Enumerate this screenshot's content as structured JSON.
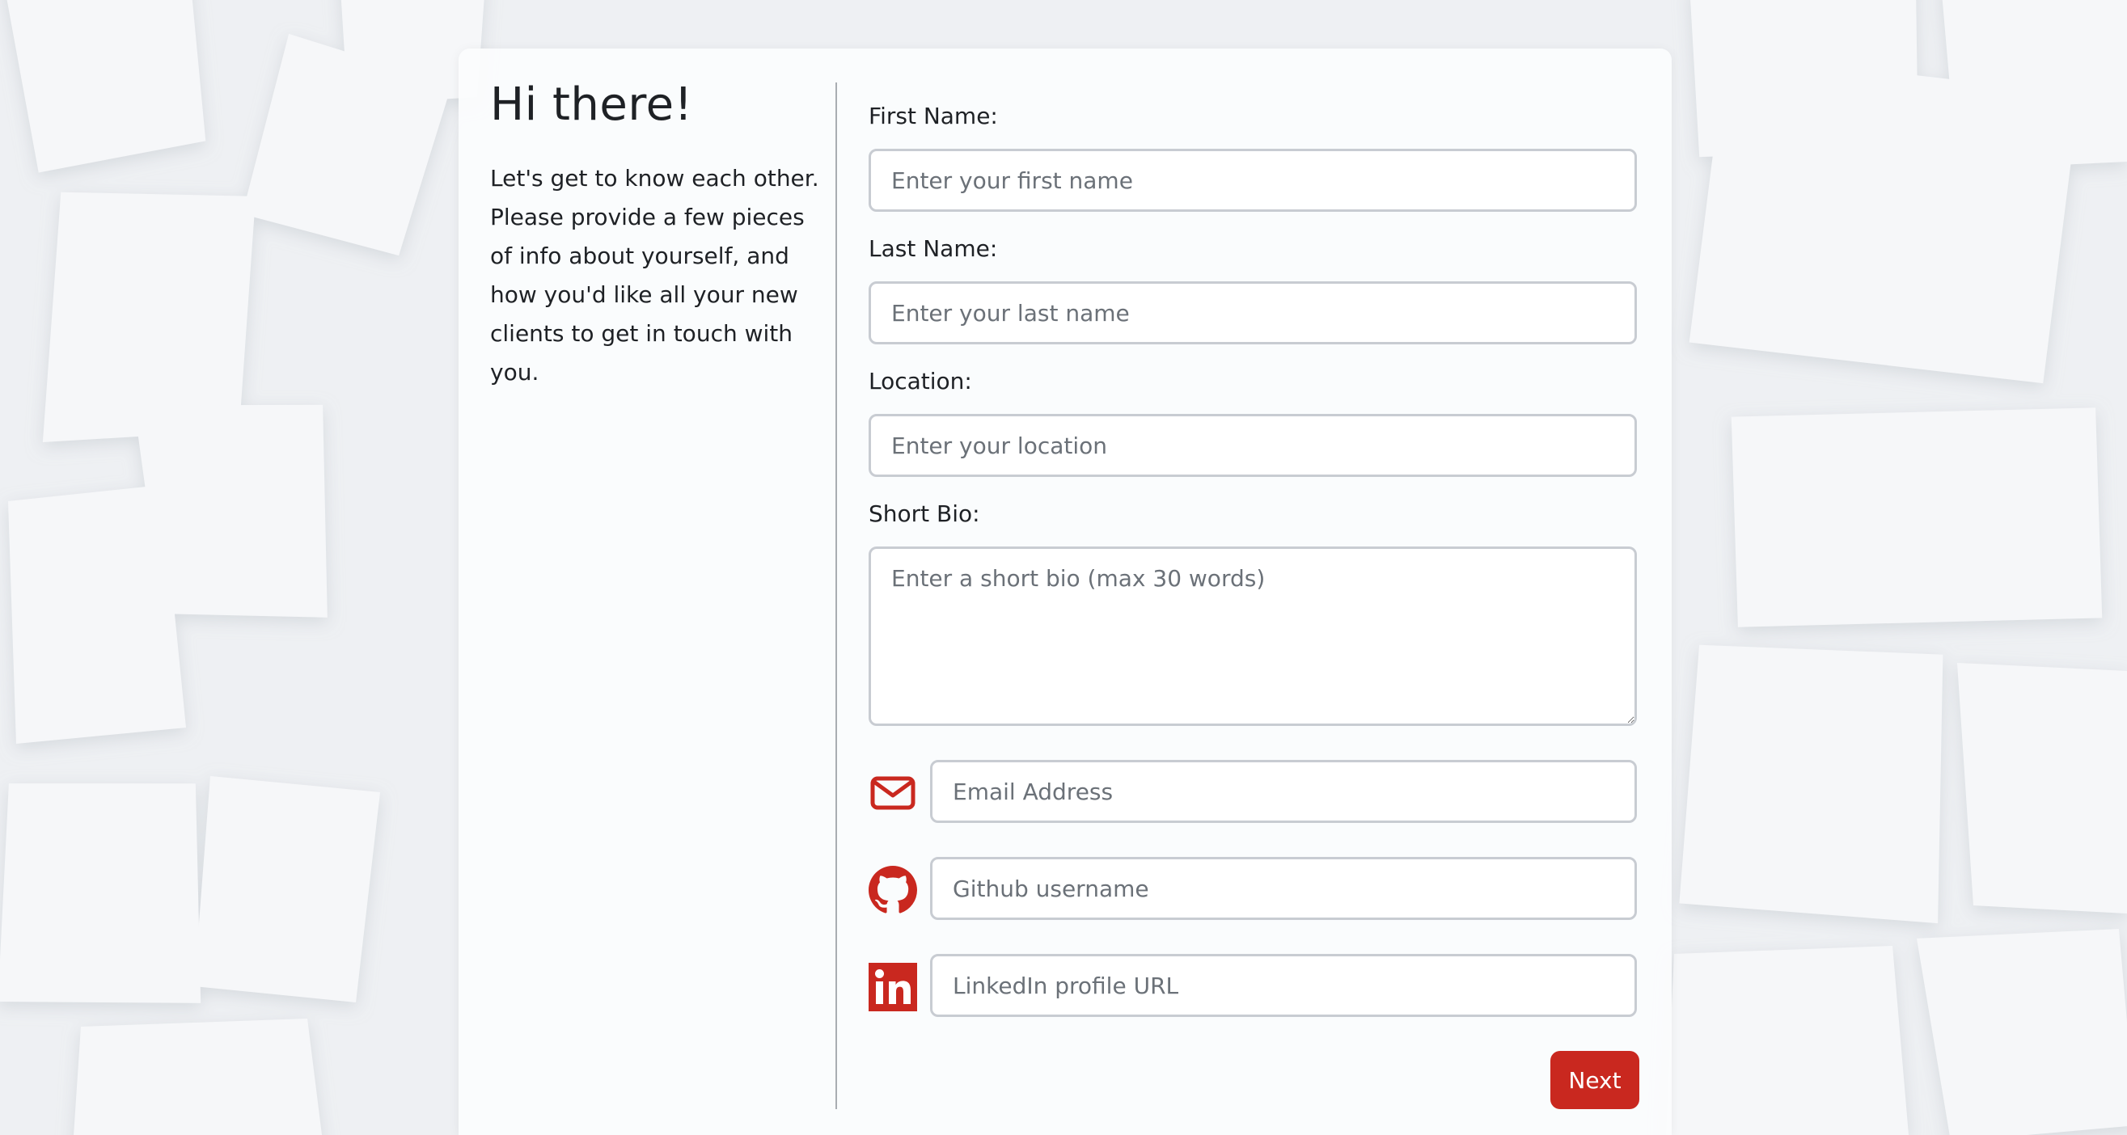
{
  "intro": {
    "greeting": "Hi there!",
    "description": "Let's get to know each other. Please provide a few pieces of info about yourself, and how you'd like all your new clients to get in touch with you."
  },
  "form": {
    "first_name": {
      "label": "First Name:",
      "placeholder": "Enter your first name"
    },
    "last_name": {
      "label": "Last Name:",
      "placeholder": "Enter your last name"
    },
    "location": {
      "label": "Location:",
      "placeholder": "Enter your location"
    },
    "bio": {
      "label": "Short Bio:",
      "placeholder": "Enter a short bio (max 30 words)"
    },
    "email": {
      "icon": "envelope-icon",
      "placeholder": "Email Address"
    },
    "github": {
      "icon": "github-icon",
      "placeholder": "Github username"
    },
    "linkedin": {
      "icon": "linkedin-icon",
      "placeholder": "LinkedIn profile URL"
    },
    "next_label": "Next"
  },
  "colors": {
    "accent": "#c9281f",
    "text": "#1e2125",
    "placeholder": "#6b7178",
    "input_border": "#c8ccd2",
    "background": "#eef0f3"
  }
}
